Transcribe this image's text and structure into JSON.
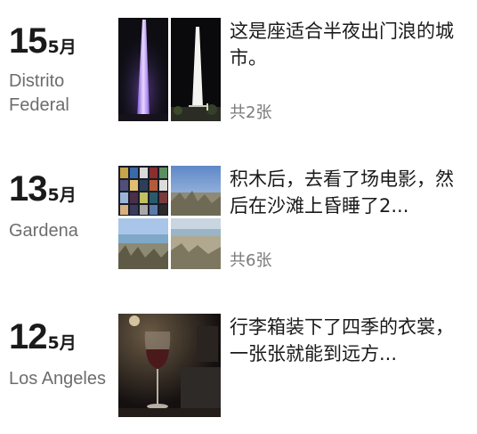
{
  "entries": [
    {
      "day": "15",
      "month": "5月",
      "location": "Distrito Federal",
      "description": "这是座适合半夜出门浪的城市。",
      "count": "共2张",
      "photos": [
        "photo-purple-monument",
        "photo-white-monument"
      ]
    },
    {
      "day": "13",
      "month": "5月",
      "location": "Gardena",
      "description": "积木后，去看了场电影，然后在沙滩上昏睡了2...",
      "count": "共6张",
      "photos": [
        "photo-movie-wall",
        "photo-beach-sky",
        "photo-beach-shore",
        "photo-beach-sand"
      ]
    },
    {
      "day": "12",
      "month": "5月",
      "location": "Los Angeles",
      "description": "行李箱装下了四季的衣裳，一张张就能到远方...",
      "count": "",
      "photos": [
        "photo-wine-glass"
      ]
    }
  ],
  "colors": {
    "text_primary": "#1a1a1a",
    "text_secondary": "#6d6d6d",
    "background": "#ffffff"
  }
}
